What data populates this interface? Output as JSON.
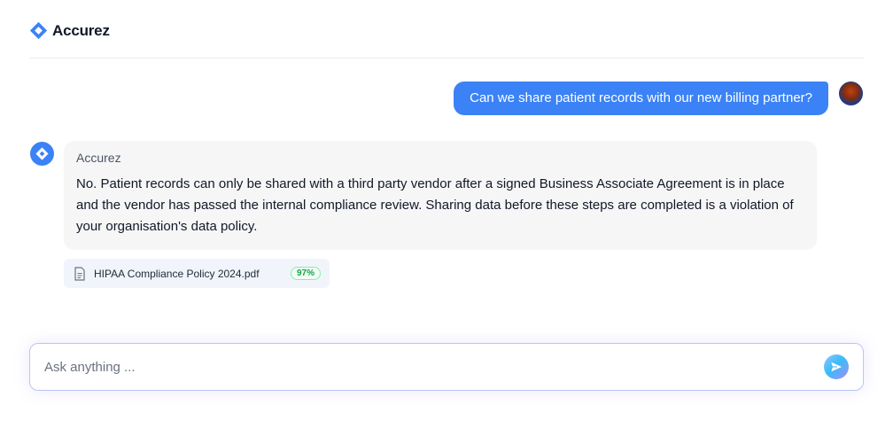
{
  "app": {
    "brand_name": "Accurez",
    "logo_icon": "diamond-logo-icon",
    "accent_color": "#3b82f6"
  },
  "conversation": {
    "user_message": "Can we share patient records with our new billing partner?",
    "user_avatar": "user-photo-avatar",
    "bot": {
      "name": "Accurez",
      "avatar_icon": "accurez-logo-icon",
      "message": "No. Patient records can only be shared with a third party vendor after a signed Business Associate Agreement is in place and the vendor has passed the internal compliance review. Sharing data before these steps are completed is a violation of your organisation's data policy."
    },
    "sources": [
      {
        "icon": "document-icon",
        "name": "HIPAA Compliance Policy 2024.pdf",
        "score": "97%",
        "score_color": "#16a34a"
      }
    ]
  },
  "composer": {
    "placeholder": "Ask anything ...",
    "value": "",
    "send_icon": "send-arrow-icon"
  }
}
